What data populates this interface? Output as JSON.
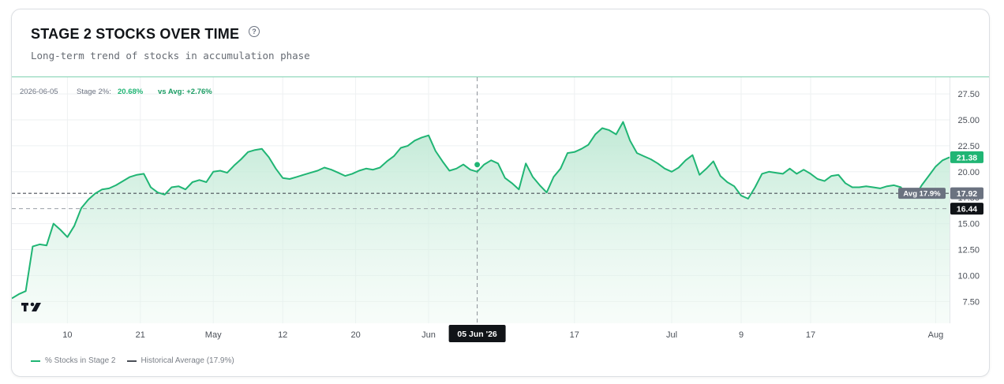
{
  "header": {
    "title": "STAGE 2 STOCKS OVER TIME",
    "help_icon": "question-circle-icon",
    "subtitle": "Long-term trend of stocks in accumulation phase"
  },
  "crosshair_info": {
    "date": "2026-06-05",
    "stage_label": "Stage 2%:",
    "stage_value": "20.68%",
    "avg_diff": "vs Avg: +2.76%",
    "x_label": "05 Jun '26"
  },
  "price_scale": {
    "last_value_label": "21.38",
    "avg_line_label": "17.92",
    "avg_tag": "Avg 17.9%",
    "crosshair_value_label": "16.44"
  },
  "legend": {
    "series_label": "% Stocks in Stage 2",
    "avg_label": "Historical Average (17.9%)"
  },
  "logo": "tradingview-logo-icon",
  "colors": {
    "line": "#20b574",
    "fill_top": "#bde8d3",
    "avg_line": "#4a4f57",
    "last_tag": "#20b574",
    "avg_tag": "#6b7280",
    "crosshair_tag": "#111418"
  },
  "chart_data": {
    "type": "area",
    "y_ticks": [
      "7.50",
      "10.00",
      "12.50",
      "15.00",
      "17.50",
      "20.00",
      "22.50",
      "25.00",
      "27.50"
    ],
    "ylim": [
      5.4,
      29.1
    ],
    "x_ticks": [
      {
        "label": "10",
        "x": 8
      },
      {
        "label": "21",
        "x": 18.5
      },
      {
        "label": "May",
        "x": 29
      },
      {
        "label": "12",
        "x": 39
      },
      {
        "label": "20",
        "x": 49.5
      },
      {
        "label": "Jun",
        "x": 60
      },
      {
        "label": "17",
        "x": 81
      },
      {
        "label": "Jul",
        "x": 95
      },
      {
        "label": "9",
        "x": 105
      },
      {
        "label": "17",
        "x": 115
      },
      {
        "label": "Aug",
        "x": 133
      }
    ],
    "avg": 17.92,
    "crosshair_value": 16.44,
    "crosshair_x": 67,
    "marker": {
      "x": 67,
      "y": 20.68
    },
    "series": [
      {
        "name": "% Stocks in Stage 2",
        "x": [
          0,
          1,
          2,
          3,
          4,
          5,
          6,
          7,
          8,
          9,
          10,
          11,
          12,
          13,
          14,
          15,
          16,
          17,
          18,
          19,
          20,
          21,
          22,
          23,
          24,
          25,
          26,
          27,
          28,
          29,
          30,
          31,
          32,
          33,
          34,
          35,
          36,
          37,
          38,
          39,
          40,
          41,
          42,
          43,
          44,
          45,
          46,
          47,
          48,
          49,
          50,
          51,
          52,
          53,
          54,
          55,
          56,
          57,
          58,
          59,
          60,
          61,
          62,
          63,
          64,
          65,
          66,
          67,
          68,
          69,
          70,
          71,
          72,
          73,
          74,
          75,
          76,
          77,
          78,
          79,
          80,
          81,
          82,
          83,
          84,
          85,
          86,
          87,
          88,
          89,
          90,
          91,
          92,
          93,
          94,
          95,
          96,
          97,
          98,
          99,
          100,
          101,
          102,
          103,
          104,
          105,
          106,
          107,
          108,
          109,
          110,
          111,
          112,
          113,
          114,
          115,
          116,
          117,
          118,
          119,
          120,
          121,
          122,
          123,
          124,
          125,
          126,
          127,
          128,
          129,
          130,
          131,
          132,
          133,
          134,
          135
        ],
        "values": [
          7.8,
          8.2,
          8.5,
          12.8,
          13.0,
          12.9,
          15.0,
          14.4,
          13.7,
          14.8,
          16.5,
          17.3,
          17.9,
          18.3,
          18.4,
          18.7,
          19.1,
          19.5,
          19.7,
          19.8,
          18.5,
          18.0,
          17.8,
          18.5,
          18.6,
          18.3,
          19.0,
          19.2,
          19.0,
          20.0,
          20.1,
          19.9,
          20.6,
          21.2,
          21.9,
          22.1,
          22.2,
          21.4,
          20.3,
          19.4,
          19.3,
          19.5,
          19.7,
          19.9,
          20.1,
          20.4,
          20.2,
          19.9,
          19.6,
          19.8,
          20.1,
          20.3,
          20.2,
          20.4,
          21.0,
          21.5,
          22.3,
          22.5,
          23.0,
          23.3,
          23.5,
          22.0,
          21.0,
          20.1,
          20.3,
          20.7,
          20.2,
          20.0,
          20.7,
          21.1,
          20.8,
          19.4,
          18.9,
          18.3,
          20.8,
          19.5,
          18.7,
          18.0,
          19.5,
          20.3,
          21.8,
          21.9,
          22.2,
          22.6,
          23.6,
          24.2,
          24.0,
          23.6,
          24.8,
          23.0,
          21.8,
          21.5,
          21.2,
          20.8,
          20.3,
          20.0,
          20.4,
          21.1,
          21.6,
          19.7,
          20.3,
          21.0,
          19.6,
          19.0,
          18.6,
          17.7,
          17.4,
          18.5,
          19.8,
          20.0,
          19.9,
          19.8,
          20.3,
          19.8,
          20.2,
          19.8,
          19.3,
          19.1,
          19.6,
          19.7,
          18.9,
          18.5,
          18.5,
          18.6,
          18.5,
          18.4,
          18.6,
          18.7,
          18.5,
          17.5,
          17.6,
          18.7,
          19.6,
          20.5,
          21.1,
          21.4
        ]
      }
    ]
  }
}
